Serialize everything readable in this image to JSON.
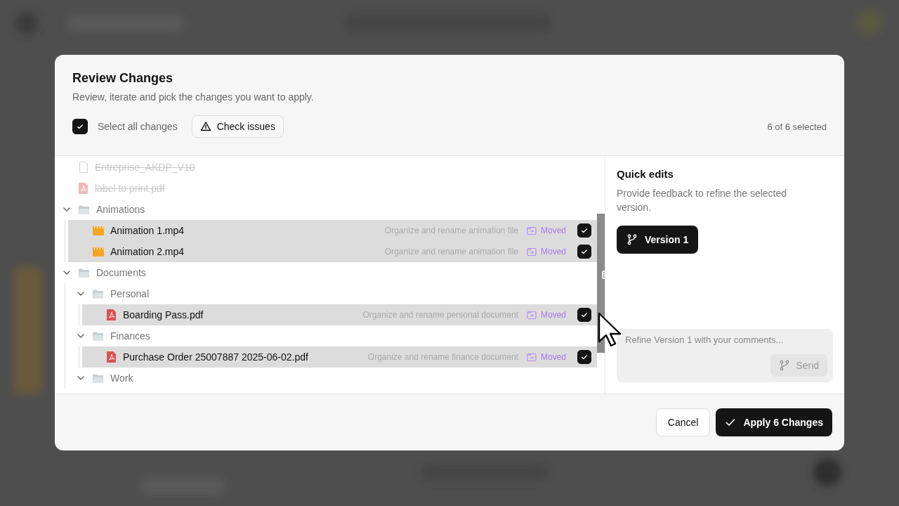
{
  "dialog": {
    "title": "Review Changes",
    "subtitle": "Review, iterate and pick the changes you want to apply."
  },
  "toolbar": {
    "select_all": {
      "label": "Select all changes",
      "checked": true
    },
    "check_issues": "Check issues",
    "selection_count": "6 of 6 selected"
  },
  "tree": [
    {
      "kind": "doc",
      "name": "Entreprise_AKDP_V10",
      "removed": true,
      "selected": false
    },
    {
      "kind": "pdf",
      "name": "label to print.pdf",
      "removed": true,
      "selected": false
    },
    {
      "kind": "folder",
      "name": "Animations",
      "expanded": true,
      "children": [
        {
          "kind": "video",
          "name": "Animation 1.mp4",
          "removed": false,
          "selected": true,
          "description": "Organize and rename animation file",
          "status": "Moved",
          "checked": true
        },
        {
          "kind": "video",
          "name": "Animation 2.mp4",
          "removed": false,
          "selected": true,
          "description": "Organize and rename animation file",
          "status": "Moved",
          "checked": true
        }
      ]
    },
    {
      "kind": "folder",
      "name": "Documents",
      "expanded": true,
      "children": [
        {
          "kind": "folder",
          "name": "Personal",
          "expanded": true,
          "children": [
            {
              "kind": "pdf",
              "name": "Boarding Pass.pdf",
              "removed": false,
              "selected": true,
              "description": "Organize and rename personal document",
              "status": "Moved",
              "checked": true
            }
          ]
        },
        {
          "kind": "folder",
          "name": "Finances",
          "expanded": true,
          "children": [
            {
              "kind": "pdf",
              "name": "Purchase Order 25007887 2025-06-02.pdf",
              "removed": false,
              "selected": true,
              "description": "Organize and rename finance document",
              "status": "Moved",
              "checked": true
            }
          ]
        },
        {
          "kind": "folder",
          "name": "Work",
          "expanded": true
        }
      ]
    }
  ],
  "quick_edits": {
    "title": "Quick edits",
    "description": "Provide feedback to refine the selected version.",
    "version_button": "Version 1",
    "comment": {
      "placeholder": "Refine Version 1 with your comments..."
    },
    "send_button": "Send"
  },
  "footer": {
    "cancel": "Cancel",
    "apply": "Apply 6 Changes"
  }
}
